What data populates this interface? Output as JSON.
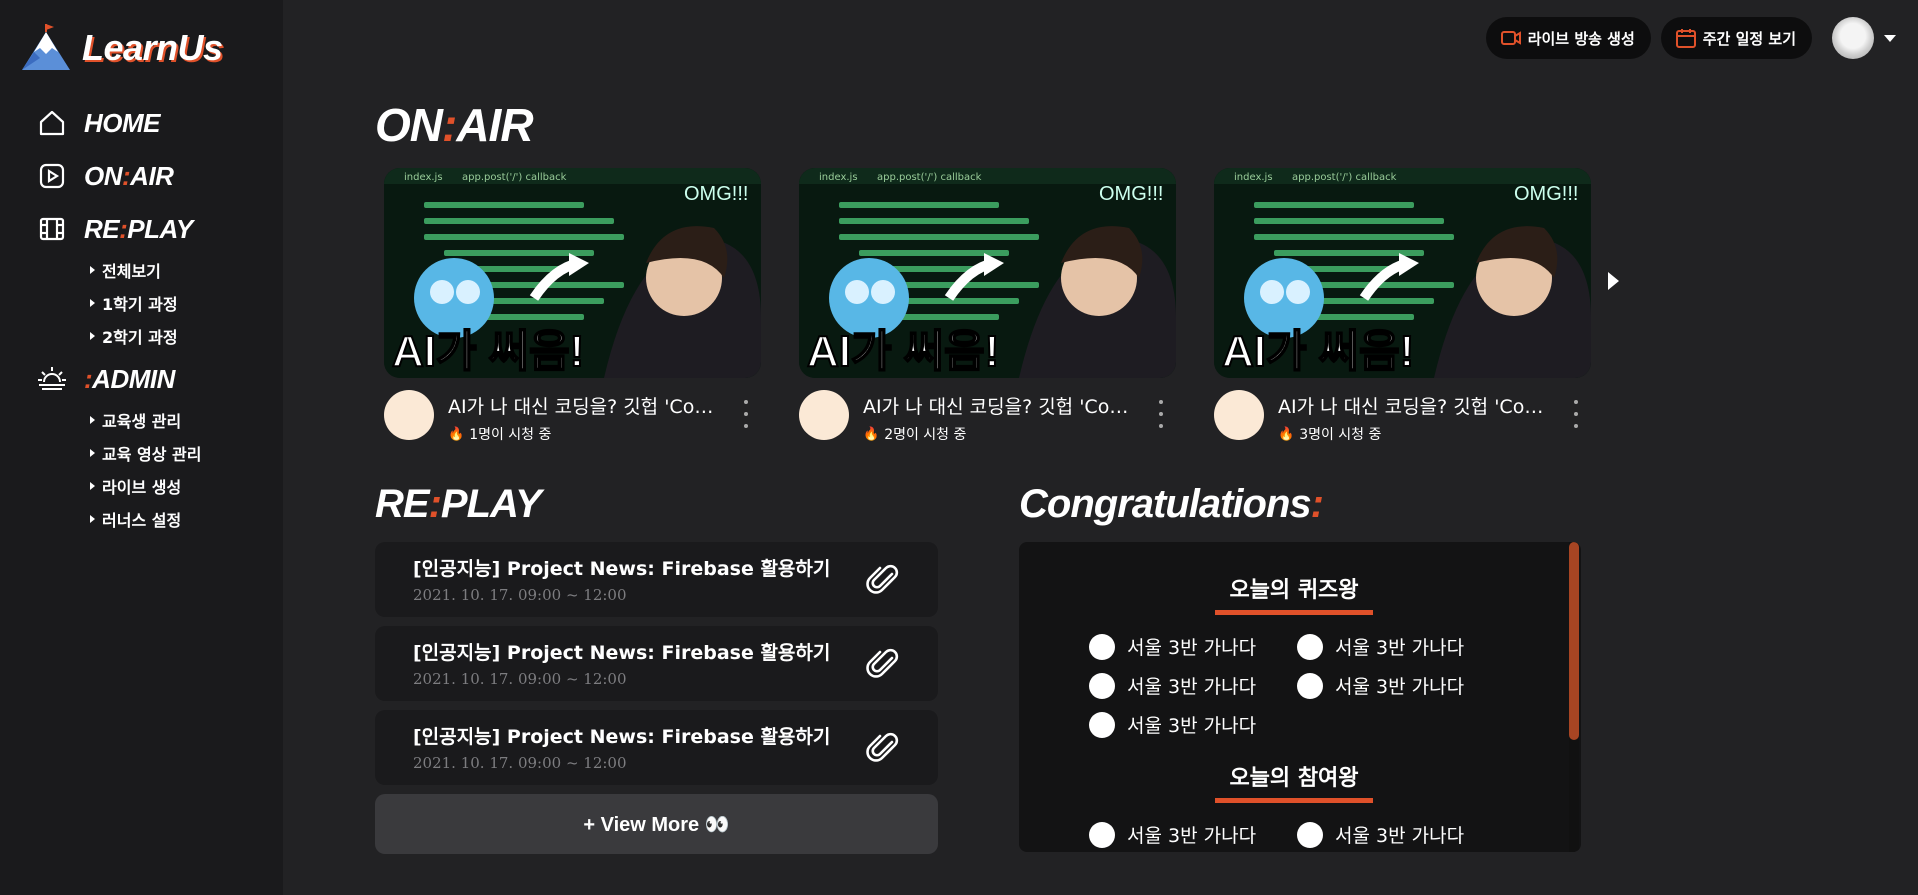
{
  "brand": {
    "name": "LearnUs"
  },
  "nav": {
    "home": "HOME",
    "onair_a": "ON",
    "onair_b": ":",
    "onair_c": "AIR",
    "replay_a": "RE",
    "replay_b": ":",
    "replay_c": "PLAY",
    "replay_sub": [
      "전체보기",
      "1학기 과정",
      "2학기 과정"
    ],
    "admin_a": ":",
    "admin_b": "ADMIN",
    "admin_sub": [
      "교육생 관리",
      "교육 영상 관리",
      "라이브 생성",
      "러너스 설정"
    ]
  },
  "topbar": {
    "live_button": "라이브 방송 생성",
    "schedule_button": "주간 일정 보기"
  },
  "onair": {
    "title_a": "ON",
    "title_b": ":",
    "title_c": "AIR",
    "cards": [
      {
        "title": "AI가 나 대신 코딩을? 깃헙 'Co…",
        "viewers": "1명이 시청 중"
      },
      {
        "title": "AI가 나 대신 코딩을? 깃헙 'Co…",
        "viewers": "2명이 시청 중"
      },
      {
        "title": "AI가 나 대신 코딩을? 깃헙 'Co…",
        "viewers": "3명이 시청 중"
      }
    ],
    "thumb_caption": "AI가 써음!",
    "thumb_tag": "OMG!!!",
    "thumb_file": "index.js",
    "thumb_crumb": "app.post('/') callback"
  },
  "replay": {
    "title_a": "RE",
    "title_b": ":",
    "title_c": "PLAY",
    "items": [
      {
        "title": "[인공지능] Project News: Firebase 활용하기",
        "date": "2021. 10. 17. 09:00 ~ 12:00"
      },
      {
        "title": "[인공지능] Project News: Firebase 활용하기",
        "date": "2021. 10. 17. 09:00 ~ 12:00"
      },
      {
        "title": "[인공지능] Project News: Firebase 활용하기",
        "date": "2021. 10. 17. 09:00 ~ 12:00"
      }
    ],
    "view_more": "+ View More 👀"
  },
  "congrats": {
    "title_a": "Congratulations",
    "title_b": ":",
    "quiz_title": "오늘의 퀴즈왕",
    "quiz_winners": [
      "서울 3반 가나다",
      "서울 3반 가나다",
      "서울 3반 가나다",
      "서울 3반 가나다",
      "서울 3반 가나다"
    ],
    "part_title": "오늘의 참여왕",
    "part_winners": [
      "서울 3반 가나다",
      "서울 3반 가나다"
    ]
  },
  "colors": {
    "accent": "#e0512a",
    "bg": "#222224",
    "sidebar": "#1a1a1c"
  },
  "icons": {
    "home": "home-icon",
    "onair": "play-square-icon",
    "replay": "film-icon",
    "admin": "sunrise-icon",
    "live": "video-camera-icon",
    "schedule": "calendar-icon",
    "clip": "paperclip-icon"
  }
}
